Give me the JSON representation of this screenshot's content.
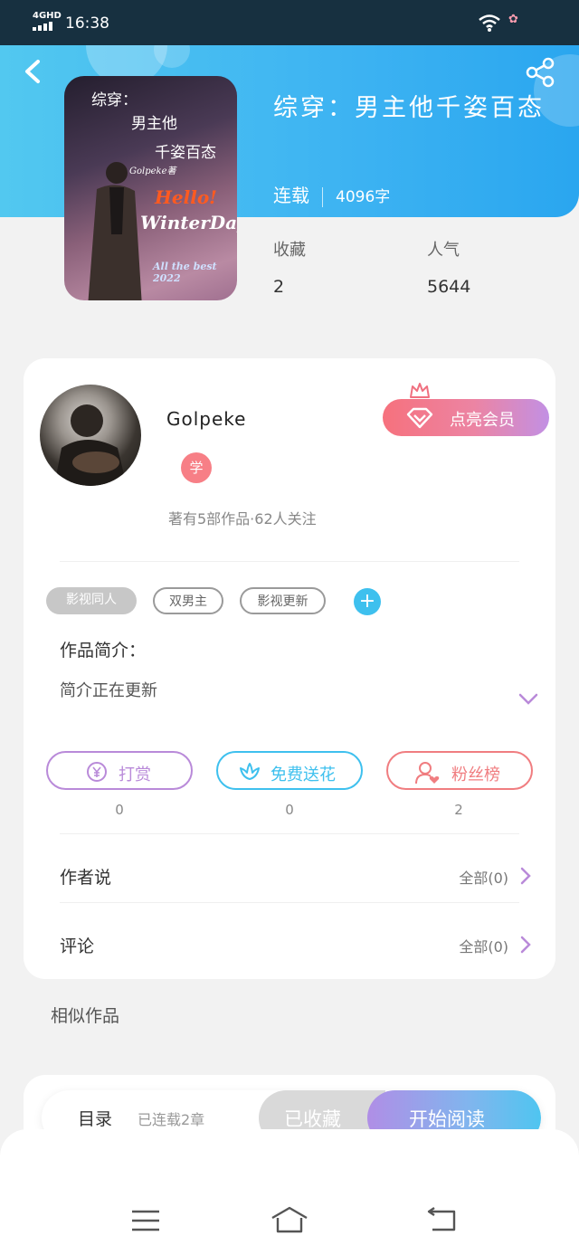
{
  "status_bar": {
    "network": "4GHD",
    "time": "16:38"
  },
  "book": {
    "title": "综穿：男主他千姿百态",
    "status": "连载",
    "word_count": "4096字",
    "cover": {
      "line1": "综穿：",
      "line2": "男主他",
      "line3": "千姿百态",
      "brand": "Golpeke著",
      "hello": "Hello!",
      "winter": "WinterDay",
      "best": "All the best 2022"
    }
  },
  "stats": {
    "favorites_label": "收藏",
    "favorites_value": "2",
    "popularity_label": "人气",
    "popularity_value": "5644"
  },
  "author": {
    "name": "Golpeke",
    "badge": "学",
    "info": "著有5部作品·62人关注",
    "vip_label": "点亮会员"
  },
  "tags": [
    "影视同人",
    "双男主",
    "影视更新"
  ],
  "intro": {
    "heading": "作品简介：",
    "text": "简介正在更新"
  },
  "actions": [
    {
      "label": "打赏",
      "count": "0",
      "color": "#b98ad9"
    },
    {
      "label": "免费送花",
      "count": "0",
      "color": "#3ec0ee"
    },
    {
      "label": "粉丝榜",
      "count": "2",
      "color": "#f07d80"
    }
  ],
  "author_says": {
    "label": "作者说",
    "right": "全部(0)"
  },
  "comments": {
    "label": "评论",
    "right": "全部(0)"
  },
  "similar_heading": "相似作品",
  "read_bar": {
    "toc": "目录",
    "chapters": "已连载2章",
    "collected": "已收藏",
    "start": "开始阅读"
  }
}
